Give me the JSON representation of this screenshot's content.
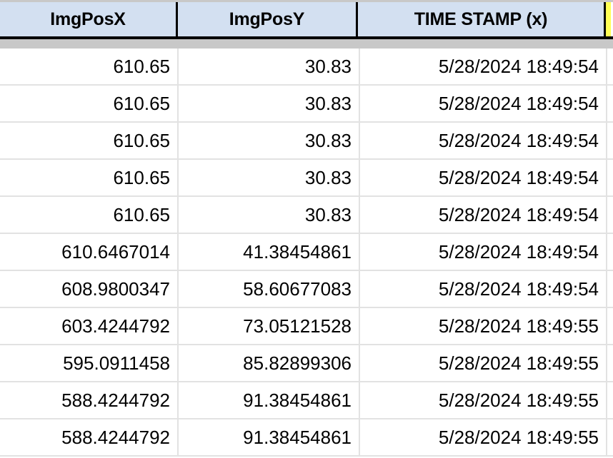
{
  "table": {
    "columns": [
      {
        "key": "img_pos_x",
        "label": "ImgPosX"
      },
      {
        "key": "img_pos_y",
        "label": "ImgPosY"
      },
      {
        "key": "time_stamp",
        "label": "TIME STAMP (x)"
      }
    ],
    "header_style": {
      "background": "#d3e0f1",
      "text_color": "#000000",
      "divider_color": "#000000",
      "right_marker_color": "#ffff55"
    },
    "row_style": {
      "background": "#ffffff",
      "separator_color": "#e2e2e2",
      "band_color": "#c8c8c8"
    },
    "rows": [
      {
        "img_pos_x": "610.65",
        "img_pos_y": "30.83",
        "time_stamp": "5/28/2024 18:49:54"
      },
      {
        "img_pos_x": "610.65",
        "img_pos_y": "30.83",
        "time_stamp": "5/28/2024 18:49:54"
      },
      {
        "img_pos_x": "610.65",
        "img_pos_y": "30.83",
        "time_stamp": "5/28/2024 18:49:54"
      },
      {
        "img_pos_x": "610.65",
        "img_pos_y": "30.83",
        "time_stamp": "5/28/2024 18:49:54"
      },
      {
        "img_pos_x": "610.65",
        "img_pos_y": "30.83",
        "time_stamp": "5/28/2024 18:49:54"
      },
      {
        "img_pos_x": "610.6467014",
        "img_pos_y": "41.38454861",
        "time_stamp": "5/28/2024 18:49:54"
      },
      {
        "img_pos_x": "608.9800347",
        "img_pos_y": "58.60677083",
        "time_stamp": "5/28/2024 18:49:54"
      },
      {
        "img_pos_x": "603.4244792",
        "img_pos_y": "73.05121528",
        "time_stamp": "5/28/2024 18:49:55"
      },
      {
        "img_pos_x": "595.0911458",
        "img_pos_y": "85.82899306",
        "time_stamp": "5/28/2024 18:49:55"
      },
      {
        "img_pos_x": "588.4244792",
        "img_pos_y": "91.38454861",
        "time_stamp": "5/28/2024 18:49:55"
      },
      {
        "img_pos_x": "588.4244792",
        "img_pos_y": "91.38454861",
        "time_stamp": "5/28/2024 18:49:55"
      }
    ]
  }
}
